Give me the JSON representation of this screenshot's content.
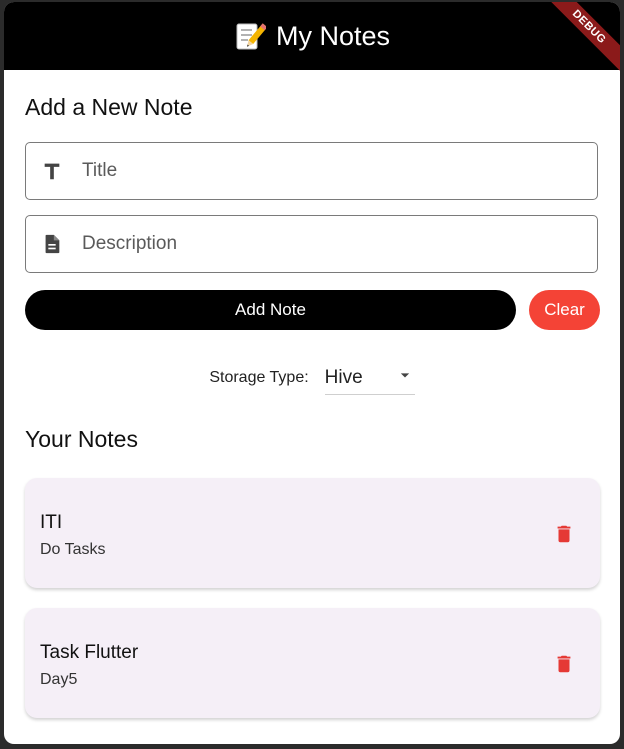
{
  "appbar": {
    "title": "My Notes",
    "icon": "memo-icon",
    "debug_banner": "DEBUG"
  },
  "add_section": {
    "title": "Add a New Note",
    "title_field": {
      "placeholder": "Title",
      "value": "",
      "icon": "text-icon"
    },
    "description_field": {
      "placeholder": "Description",
      "value": "",
      "icon": "document-icon"
    },
    "add_button_label": "Add Note",
    "clear_button_label": "Clear"
  },
  "storage": {
    "label": "Storage Type:",
    "selected": "Hive"
  },
  "notes_section": {
    "title": "Your Notes",
    "notes": [
      {
        "title": "ITI",
        "description": "Do Tasks"
      },
      {
        "title": "Task Flutter",
        "description": "Day5"
      }
    ]
  },
  "colors": {
    "appbar_bg": "#000000",
    "add_button_bg": "#000000",
    "clear_button_bg": "#f44336",
    "delete_icon": "#e53935",
    "card_bg": "#f5eff7"
  }
}
